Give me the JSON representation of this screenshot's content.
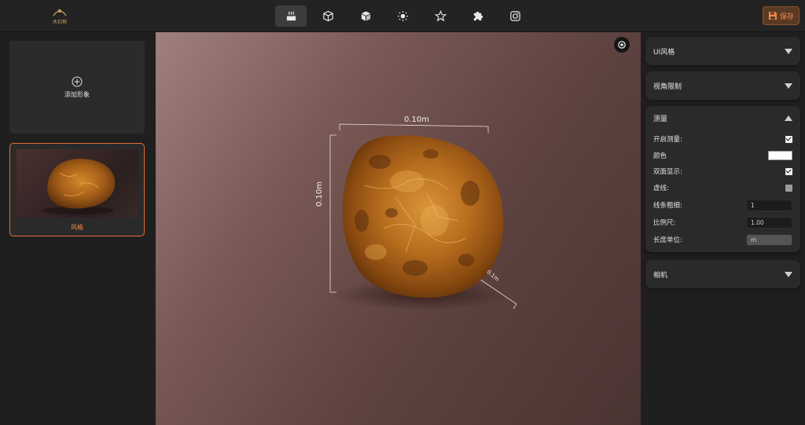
{
  "app": {
    "logo_text": "木石物"
  },
  "toolbar": {
    "tools": [
      {
        "icon": "scene-icon",
        "active": true
      },
      {
        "icon": "box-icon",
        "active": false
      },
      {
        "icon": "cube-icon",
        "active": false
      },
      {
        "icon": "light-icon",
        "active": false
      },
      {
        "icon": "star-icon",
        "active": false
      },
      {
        "icon": "puzzle-icon",
        "active": false
      },
      {
        "icon": "camera-icon",
        "active": false
      }
    ],
    "save_label": "保存"
  },
  "left_panel": {
    "add_label": "添加形象",
    "style_label": "风格"
  },
  "viewport": {
    "width_dim": "0.10m",
    "height_dim": "0.10m",
    "depth_dim": "0.1m"
  },
  "right_panel": {
    "ui_style": "UI风格",
    "view_limit": "视角限制",
    "measure": {
      "title": "测量",
      "enable_label": "开启测量:",
      "enable_checked": true,
      "color_label": "颜色",
      "color_value": "#ffffff",
      "double_side_label": "双面显示:",
      "double_side_checked": true,
      "dashed_label": "虚线:",
      "dashed_checked": false,
      "line_width_label": "线条粗细:",
      "line_width_value": "1",
      "scale_label": "比例尺:",
      "scale_value": "1.00",
      "unit_label": "长度单位:",
      "unit_value": "m"
    },
    "camera": "相机"
  },
  "colors": {
    "accent": "#f08a4b"
  }
}
